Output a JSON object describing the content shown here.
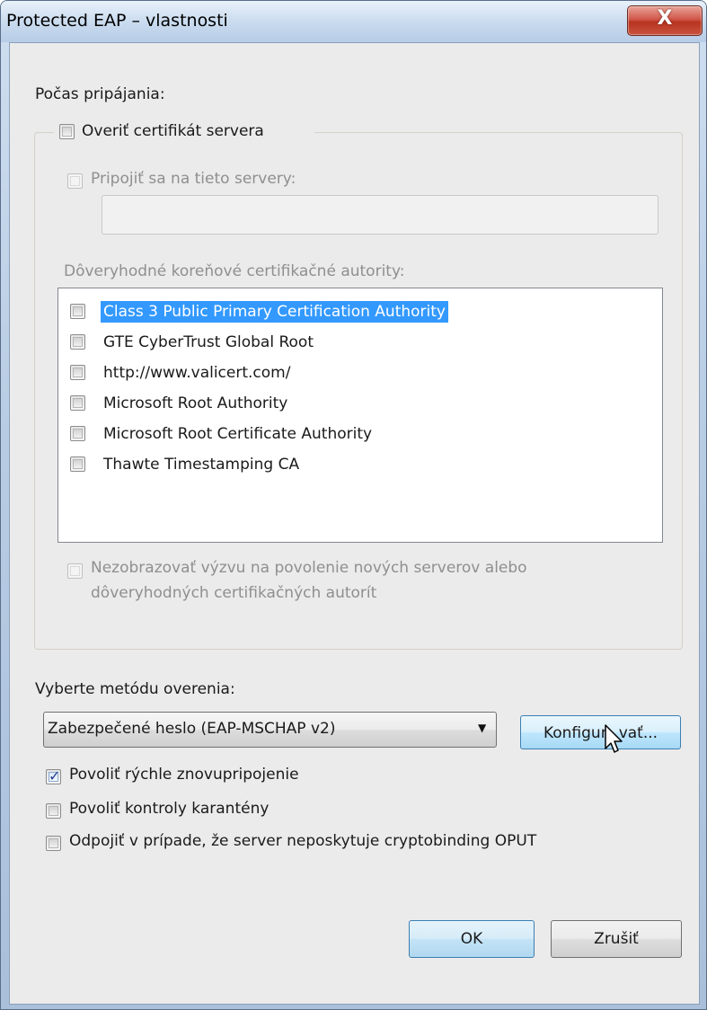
{
  "window": {
    "title": "Protected EAP – vlastnosti",
    "close_label": "X"
  },
  "connecting": {
    "heading": "Počas pripájania:",
    "verify_cert_label": "Overiť certifikát servera",
    "verify_cert_checked": false,
    "connect_servers_label": "Pripojiť sa na tieto servery:",
    "connect_servers_value": "",
    "trusted_ca_label": "Dôveryhodné koreňové certifikačné autority:",
    "trusted_ca_items": [
      {
        "label": "Class 3 Public Primary Certification Authority",
        "checked": false,
        "selected": true
      },
      {
        "label": "GTE CyberTrust Global Root",
        "checked": false,
        "selected": false
      },
      {
        "label": "http://www.valicert.com/",
        "checked": false,
        "selected": false
      },
      {
        "label": "Microsoft Root Authority",
        "checked": false,
        "selected": false
      },
      {
        "label": "Microsoft Root Certificate Authority",
        "checked": false,
        "selected": false
      },
      {
        "label": "Thawte Timestamping CA",
        "checked": false,
        "selected": false
      }
    ],
    "no_prompt_line1": "Nezobrazovať výzvu na povolenie nových serverov alebo",
    "no_prompt_line2": "dôveryhodných certifikačných autorít"
  },
  "auth": {
    "heading": "Vyberte metódu overenia:",
    "method_selected": "Zabezpečené heslo (EAP-MSCHAP v2)",
    "configure_label": "Konfigurovať...",
    "configure_visible": [
      "Konfigur",
      "vať..."
    ]
  },
  "options": [
    {
      "label": "Povoliť rýchle znovupripojenie",
      "checked": true
    },
    {
      "label": "Povoliť kontroly karantény",
      "checked": false
    },
    {
      "label": "Odpojiť v prípade, že server neposkytuje cryptobinding OPUT",
      "checked": false
    }
  ],
  "buttons": {
    "ok": "OK",
    "cancel": "Zrušiť"
  },
  "colors": {
    "selection": "#3399ff",
    "dialog_bg": "#ecebeb",
    "close_red": "#c9533f"
  }
}
